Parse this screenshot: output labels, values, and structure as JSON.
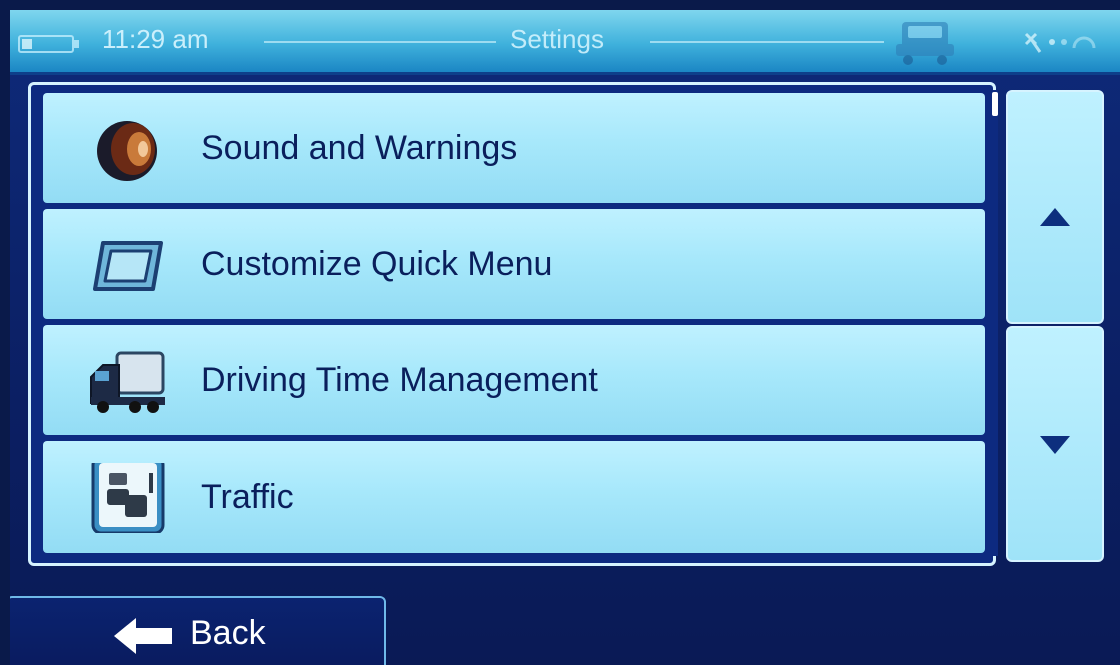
{
  "status_bar": {
    "time": "11:29 am",
    "title": "Settings"
  },
  "settings_list": {
    "items": [
      {
        "label": "Sound and Warnings",
        "icon": "speaker-icon"
      },
      {
        "label": "Customize Quick Menu",
        "icon": "quick-menu-icon"
      },
      {
        "label": "Driving Time Management",
        "icon": "truck-icon"
      },
      {
        "label": "Traffic",
        "icon": "traffic-icon"
      }
    ]
  },
  "scroll": {
    "up_icon": "chevron-up-icon",
    "down_icon": "chevron-down-icon"
  },
  "footer": {
    "back_label": "Back",
    "back_icon": "arrow-left-icon"
  },
  "colors": {
    "accent": "#3fb1dc",
    "row_background": "#a7e8fb",
    "text_dark": "#0a1f5c",
    "frame_blue": "#0d2a80"
  }
}
